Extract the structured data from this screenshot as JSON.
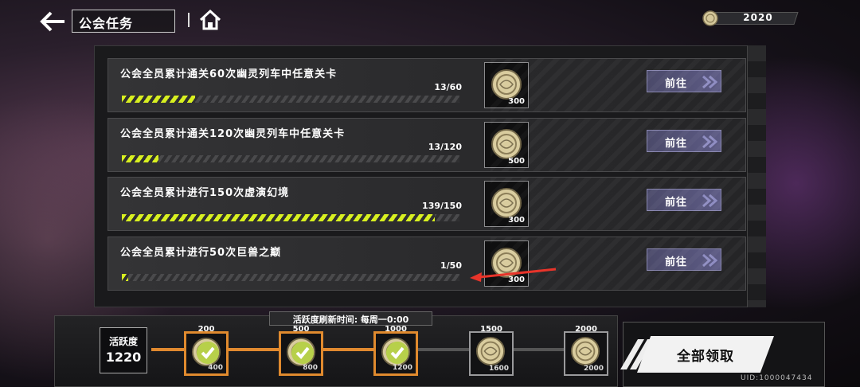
{
  "header": {
    "title": "公会任务",
    "coins": "2020"
  },
  "tasks": [
    {
      "title": "公会全员累计通关60次幽灵列车中任意关卡",
      "progress_text": "13/60",
      "progress": 0.2167,
      "reward": "300",
      "button": "前往"
    },
    {
      "title": "公会全员累计通关120次幽灵列车中任意关卡",
      "progress_text": "13/120",
      "progress": 0.1083,
      "reward": "500",
      "button": "前往"
    },
    {
      "title": "公会全员累计进行150次虚演幻境",
      "progress_text": "139/150",
      "progress": 0.9267,
      "reward": "300",
      "button": "前往"
    },
    {
      "title": "公会全员累计进行50次巨兽之巅",
      "progress_text": "1/50",
      "progress": 0.02,
      "reward": "300",
      "button": "前往"
    }
  ],
  "activity": {
    "refresh_text": "活跃度刷新时间: 每周一0:00",
    "label": "活跃度",
    "value": "1220",
    "milestones": [
      {
        "threshold": "200",
        "reward": "400",
        "claimed": true
      },
      {
        "threshold": "500",
        "reward": "800",
        "claimed": true
      },
      {
        "threshold": "1000",
        "reward": "1200",
        "claimed": true
      },
      {
        "threshold": "1500",
        "reward": "1600",
        "claimed": false
      },
      {
        "threshold": "2000",
        "reward": "2000",
        "claimed": false
      }
    ]
  },
  "claim_all": "全部领取",
  "uid": "UID:1000047434",
  "colors": {
    "progress": "#d8f020",
    "claimed_border": "#e08a2e",
    "button": "#5d5b85",
    "arrow": "#e8342a"
  }
}
